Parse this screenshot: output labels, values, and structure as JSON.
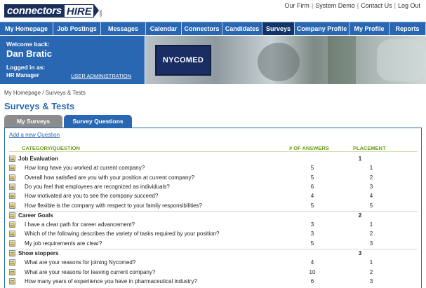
{
  "logo": {
    "part1": "connectors",
    "part2": "HIRE",
    "part3": ".com"
  },
  "toplinks": [
    "Our Firm",
    "System Demo",
    "Contact Us",
    "Log Out"
  ],
  "nav": [
    {
      "label": "My Homepage",
      "w": 76
    },
    {
      "label": "Job Postings",
      "w": 68
    },
    {
      "label": "Messages",
      "w": 64
    },
    {
      "label": "Calendar",
      "w": 51
    },
    {
      "label": "Connectors",
      "w": 58
    },
    {
      "label": "Candidates",
      "w": 57
    },
    {
      "label": "Surveys",
      "w": 46,
      "active": true
    },
    {
      "label": "Company Profile",
      "w": 78
    },
    {
      "label": "My Profile",
      "w": 57
    },
    {
      "label": "Reports",
      "w": 52
    }
  ],
  "welcome": {
    "welcome_back": "Welcome back:",
    "name": "Dan Bratic",
    "logged_in_as": "Logged in as:",
    "role": "HR Manager",
    "admin_link": "USER ADMINISTRATION"
  },
  "banner": {
    "brand": "NYCOMED"
  },
  "breadcrumb": "My Homepage / Surveys & Tests",
  "page_title": "Surveys & Tests",
  "tabs": [
    {
      "label": "My Surveys",
      "active": false
    },
    {
      "label": "Survey Questions",
      "active": true
    }
  ],
  "panel": {
    "add_question": "Add a new Question",
    "headers": {
      "category": "CATEGORY/QUESTION",
      "answers": "# OF ANSWERS",
      "placement": "PLACEMENT"
    },
    "categories": [
      {
        "name": "Job Evaluation",
        "placement": "1",
        "questions": [
          {
            "text": "How long have you worked at current company?",
            "answers": "5",
            "placement": "1"
          },
          {
            "text": "Overall how satisfied are you with your position at current company?",
            "answers": "5",
            "placement": "2"
          },
          {
            "text": "Do you feel that employees are recognized as individuals?",
            "answers": "6",
            "placement": "3"
          },
          {
            "text": "How motivated are you to see the company succeed?",
            "answers": "4",
            "placement": "4"
          },
          {
            "text": "How flexible is the company with respect to your family responsibilities?",
            "answers": "5",
            "placement": "5"
          }
        ]
      },
      {
        "name": "Career Goals",
        "placement": "2",
        "questions": [
          {
            "text": "I have a clear path for career advancement?",
            "answers": "3",
            "placement": "1"
          },
          {
            "text": "Which of the following describes the variety of tasks required by your position?",
            "answers": "3",
            "placement": "2"
          },
          {
            "text": "My job requirements are clear?",
            "answers": "5",
            "placement": "3"
          }
        ]
      },
      {
        "name": "Show stoppers",
        "placement": "3",
        "questions": [
          {
            "text": "What are your reasons for joining Nycomed?",
            "answers": "4",
            "placement": "1"
          },
          {
            "text": "What are your reasons for leaving current company?",
            "answers": "10",
            "placement": "2"
          },
          {
            "text": "How many years of experiience you have in pharmaceutical industry?",
            "answers": "6",
            "placement": "3"
          }
        ]
      }
    ]
  }
}
